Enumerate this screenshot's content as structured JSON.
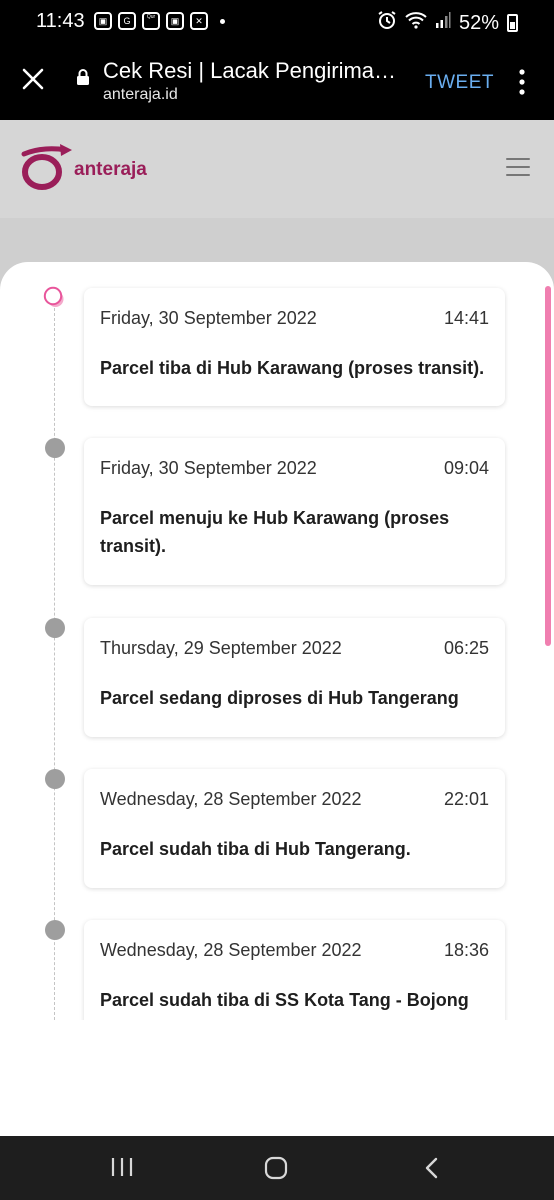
{
  "status_bar": {
    "time": "11:43",
    "battery": "52%",
    "app_icons": [
      "G",
      "Quran Belajar",
      "✕"
    ]
  },
  "custom_tab": {
    "title": "Cek Resi | Lacak Pengiriman Paket – Anteraja",
    "domain": "anteraja.id",
    "tweet_label": "TWEET"
  },
  "site": {
    "logo_text": "anteraja",
    "brand_color": "#9a1e59",
    "accent_color": "#e8559b"
  },
  "tracking": [
    {
      "date": "Friday, 30 September 2022",
      "time": "14:41",
      "description": "Parcel tiba di Hub Karawang (proses transit).",
      "active": true
    },
    {
      "date": "Friday, 30 September 2022",
      "time": "09:04",
      "description": "Parcel menuju ke Hub Karawang (proses transit).",
      "active": false
    },
    {
      "date": "Thursday, 29 September 2022",
      "time": "06:25",
      "description": "Parcel sedang diproses di Hub Tangerang",
      "active": false
    },
    {
      "date": "Wednesday, 28 September 2022",
      "time": "22:01",
      "description": "Parcel sudah tiba di Hub Tangerang.",
      "active": false
    },
    {
      "date": "Wednesday, 28 September 2022",
      "time": "18:36",
      "description": "Parcel sudah tiba di SS Kota Tang - Bojong Nangka (proses transit).",
      "active": false
    }
  ]
}
